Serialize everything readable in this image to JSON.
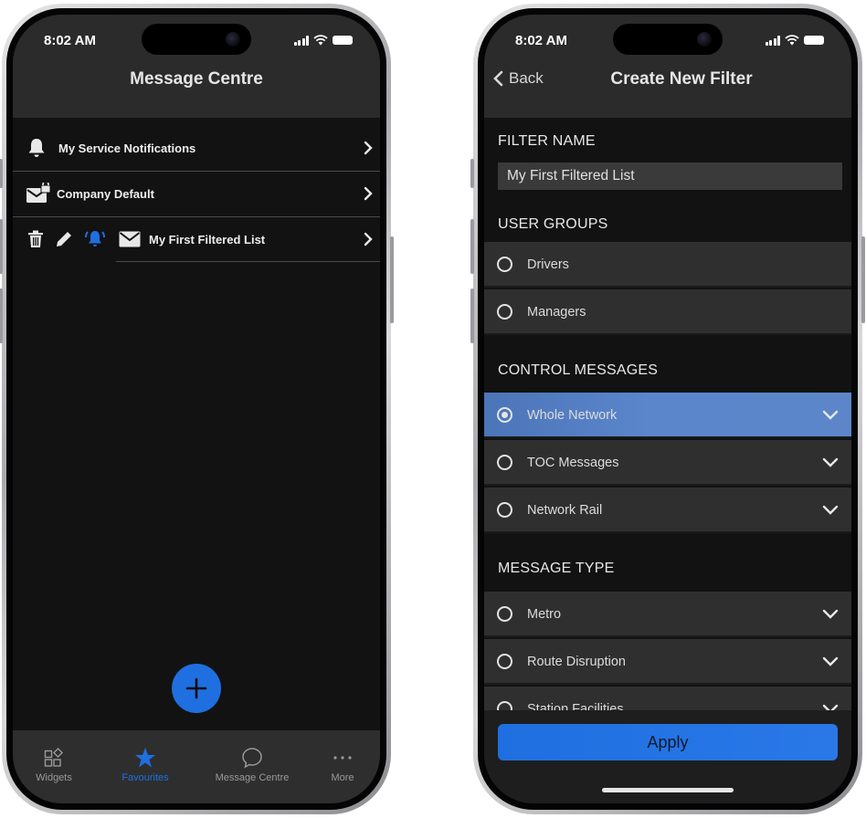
{
  "left_screen": {
    "status": {
      "time": "8:02 AM"
    },
    "title": "Message Centre",
    "rows": [
      {
        "icon": "bell-icon",
        "label": "My Service Notifications"
      },
      {
        "icon": "envelope-lock-icon",
        "label": "Company Default"
      },
      {
        "icon": "envelope-icon",
        "label": "My First Filtered List"
      }
    ],
    "row_actions": [
      "trash-icon",
      "pencil-icon",
      "ringing-bell-icon"
    ],
    "tabs": [
      {
        "label": "Widgets",
        "icon": "widgets-icon",
        "active": false
      },
      {
        "label": "Favourites",
        "icon": "star-icon",
        "active": true
      },
      {
        "label": "Message Centre",
        "icon": "chat-bubble-icon",
        "active": false
      },
      {
        "label": "More",
        "icon": "ellipsis-icon",
        "active": false
      }
    ],
    "colors": {
      "accent": "#1f6fe0",
      "background": "#121212",
      "header": "#2b2b2b"
    }
  },
  "right_screen": {
    "status": {
      "time": "8:02 AM"
    },
    "back_label": "Back",
    "title": "Create New Filter",
    "filter_name_label": "FILTER NAME",
    "filter_name_value": "My First Filtered List",
    "user_groups_label": "USER GROUPS",
    "user_groups": [
      {
        "label": "Drivers",
        "selected": false
      },
      {
        "label": "Managers",
        "selected": false
      }
    ],
    "control_messages_label": "CONTROL MESSAGES",
    "control_messages": [
      {
        "label": "Whole Network",
        "selected": true
      },
      {
        "label": "TOC Messages",
        "selected": false
      },
      {
        "label": "Network Rail",
        "selected": false
      }
    ],
    "message_type_label": "MESSAGE TYPE",
    "message_types": [
      {
        "label": "Metro",
        "selected": false
      },
      {
        "label": "Route Disruption",
        "selected": false
      },
      {
        "label": "Station Facilities",
        "selected": false
      }
    ],
    "apply_label": "Apply",
    "colors": {
      "accent": "#1f6fe0",
      "selected_row": "#5a84c8"
    }
  }
}
